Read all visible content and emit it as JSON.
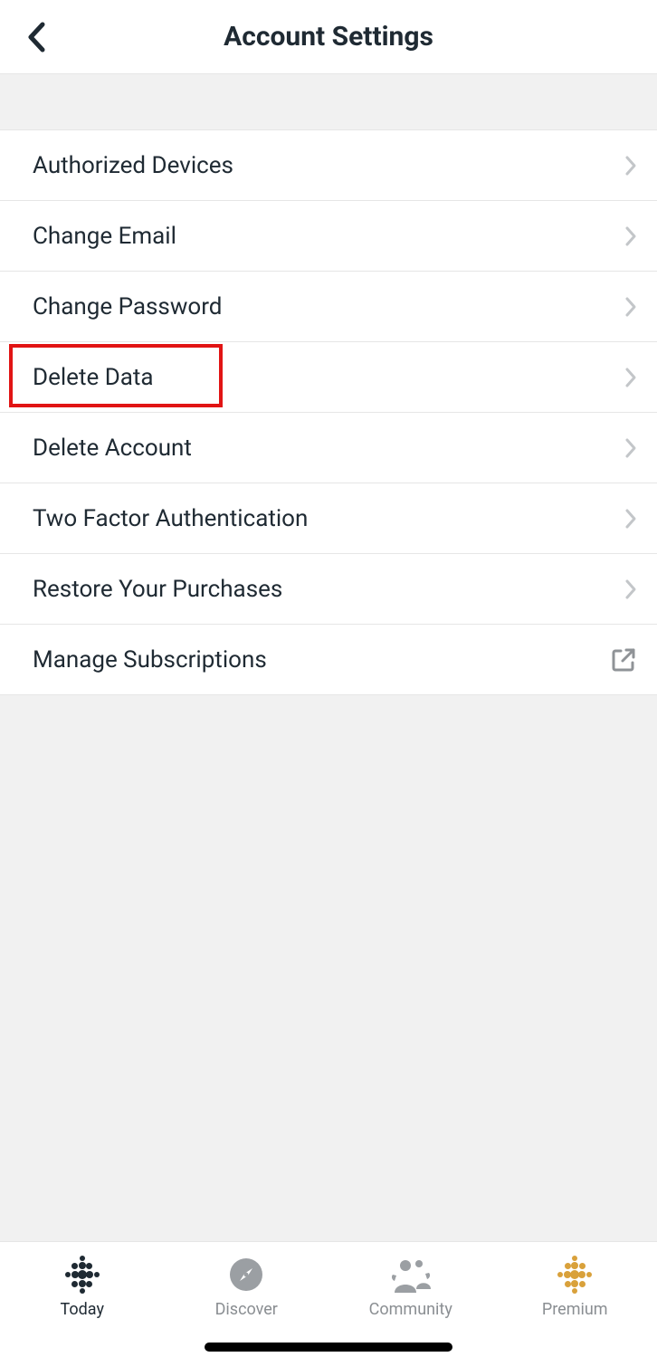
{
  "header": {
    "title": "Account Settings"
  },
  "rows": [
    {
      "label": "Authorized Devices",
      "name": "row-authorized-devices",
      "icon": "chevron"
    },
    {
      "label": "Change Email",
      "name": "row-change-email",
      "icon": "chevron"
    },
    {
      "label": "Change Password",
      "name": "row-change-password",
      "icon": "chevron"
    },
    {
      "label": "Delete Data",
      "name": "row-delete-data",
      "icon": "chevron",
      "highlighted": true
    },
    {
      "label": "Delete Account",
      "name": "row-delete-account",
      "icon": "chevron"
    },
    {
      "label": "Two Factor Authentication",
      "name": "row-two-factor-auth",
      "icon": "chevron"
    },
    {
      "label": "Restore Your Purchases",
      "name": "row-restore-purchases",
      "icon": "chevron"
    },
    {
      "label": "Manage Subscriptions",
      "name": "row-manage-subscriptions",
      "icon": "external"
    }
  ],
  "tabs": [
    {
      "label": "Today",
      "name": "tab-today",
      "icon": "today-icon",
      "active": true
    },
    {
      "label": "Discover",
      "name": "tab-discover",
      "icon": "compass-icon",
      "active": false
    },
    {
      "label": "Community",
      "name": "tab-community",
      "icon": "community-icon",
      "active": false
    },
    {
      "label": "Premium",
      "name": "tab-premium",
      "icon": "premium-icon",
      "active": false
    }
  ]
}
